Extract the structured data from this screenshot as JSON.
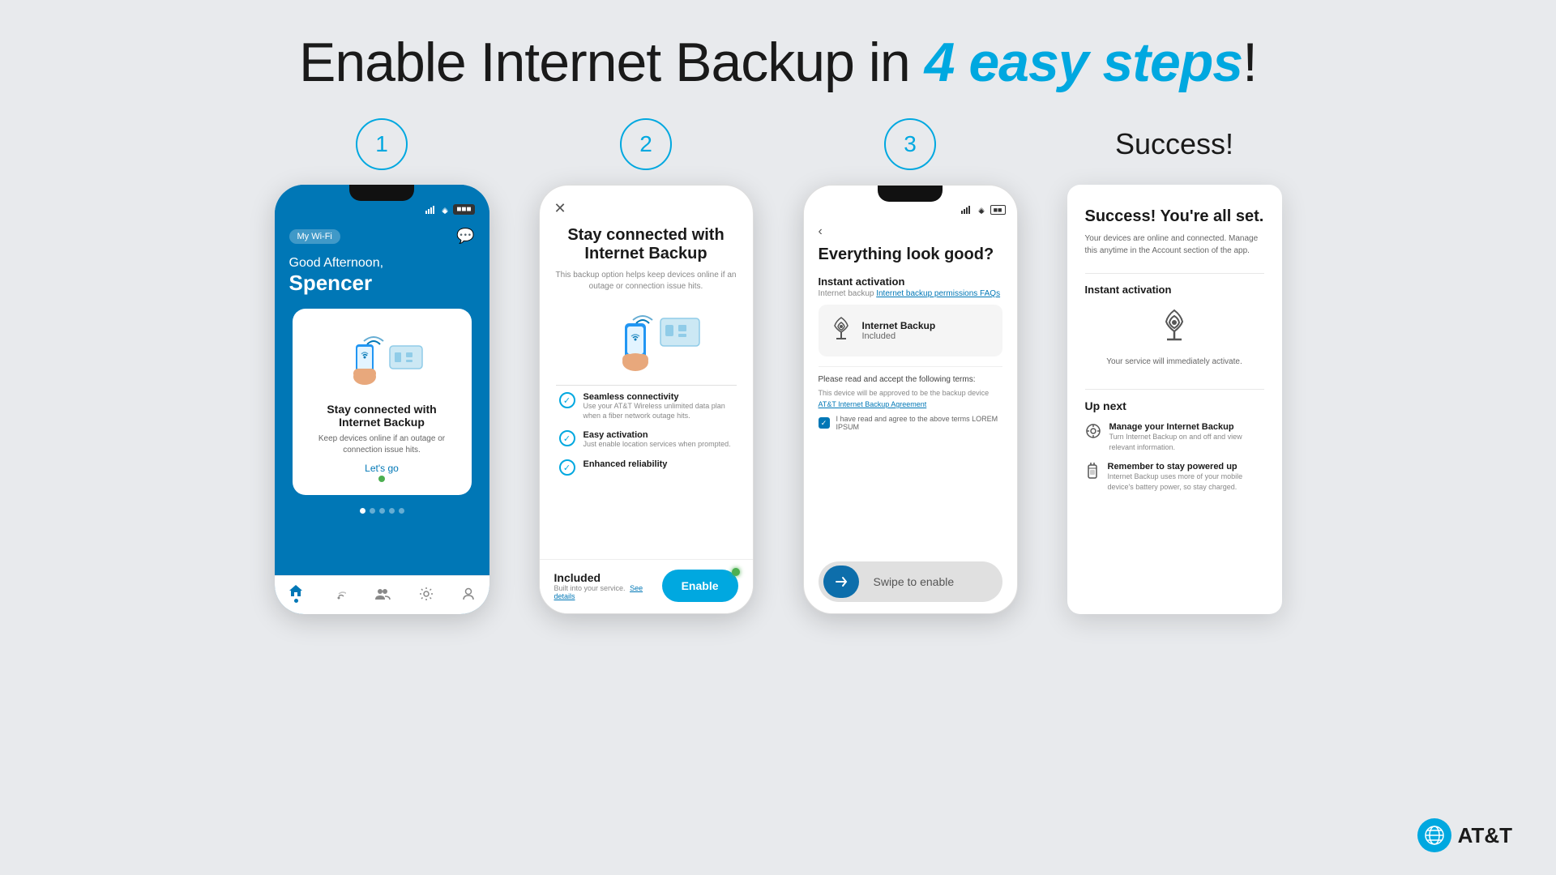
{
  "header": {
    "title_part1": "Enable Internet Backup in ",
    "title_highlight": "4 easy steps",
    "title_end": "!"
  },
  "step1": {
    "number": "1",
    "wifi_label": "My Wi-Fi",
    "greeting": "Good Afternoon,",
    "name": "Spencer",
    "card_title": "Stay connected with Internet Backup",
    "card_desc": "Keep devices online if an outage or connection issue hits.",
    "lets_go": "Let's go"
  },
  "step2": {
    "number": "2",
    "title": "Stay connected with Internet Backup",
    "subtitle": "This backup option helps keep devices online if an outage or connection issue hits.",
    "feature1_title": "Seamless connectivity",
    "feature1_desc": "Use your AT&T Wireless unlimited data plan when a fiber network outage hits.",
    "feature2_title": "Easy activation",
    "feature2_desc": "Just enable location services when prompted.",
    "feature3_title": "Enhanced reliability",
    "bottom_included": "Included",
    "bottom_sub": "Built into your service.",
    "bottom_see": "See details",
    "enable_btn": "Enable"
  },
  "step3": {
    "number": "3",
    "title": "Everything look good?",
    "instant_activation": "Instant activation",
    "permissions_faqs": "Internet backup permissions FAQs",
    "backup_title": "Internet Backup",
    "backup_sub": "Included",
    "terms_label": "Please read and accept the following terms:",
    "terms_device": "This device will be approved to be the backup device",
    "agreement_link": "AT&T Internet Backup Agreement",
    "checkbox_text": "I have read and agree to the above terms LOREM IPSUM",
    "swipe_text": "Swipe to enable"
  },
  "success": {
    "label": "Success!",
    "title": "Success! You're all set.",
    "desc": "Your devices are online and connected. Manage this anytime in the Account section of the app.",
    "instant_activation": "Instant activation",
    "your_service": "Your service will immediately activate.",
    "up_next": "Up next",
    "manage_title": "Manage your Internet Backup",
    "manage_desc": "Turn Internet Backup on and off and view relevant information.",
    "stay_title": "Remember to stay powered up",
    "stay_desc": "Internet Backup uses more of your mobile device's battery power, so stay charged."
  },
  "att_logo_text": "AT&T"
}
